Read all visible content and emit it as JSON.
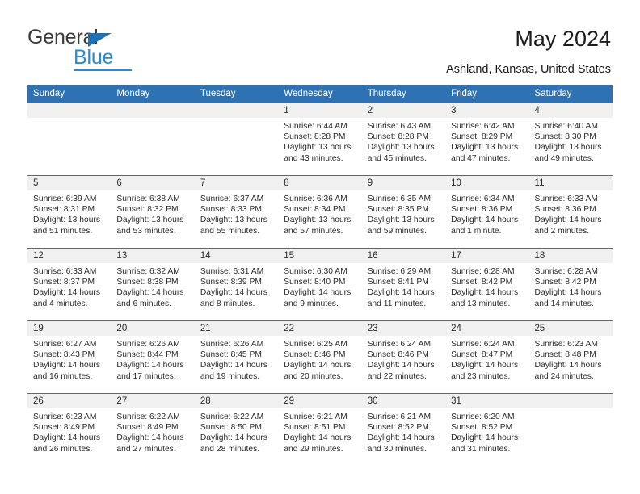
{
  "brand": {
    "name_part1": "General",
    "name_part2": "Blue",
    "triangle_color": "#1b70b8",
    "blue_color": "#2b8ad6"
  },
  "header": {
    "title": "May 2024",
    "location": "Ashland, Kansas, United States"
  },
  "theme": {
    "header_blue": "#2f72b4",
    "daynum_bg": "#f0f0f0",
    "text": "#2b2b2b"
  },
  "labels": {
    "sunrise_prefix": "Sunrise:",
    "sunset_prefix": "Sunset:",
    "daylight_prefix": "Daylight:"
  },
  "weekday_headers": [
    "Sunday",
    "Monday",
    "Tuesday",
    "Wednesday",
    "Thursday",
    "Friday",
    "Saturday"
  ],
  "weeks": [
    [
      {
        "day": "",
        "sunrise": "",
        "sunset": "",
        "daylight_line1": "",
        "daylight_line2": ""
      },
      {
        "day": "",
        "sunrise": "",
        "sunset": "",
        "daylight_line1": "",
        "daylight_line2": ""
      },
      {
        "day": "",
        "sunrise": "",
        "sunset": "",
        "daylight_line1": "",
        "daylight_line2": ""
      },
      {
        "day": "1",
        "sunrise": "Sunrise: 6:44 AM",
        "sunset": "Sunset: 8:28 PM",
        "daylight_line1": "Daylight: 13 hours",
        "daylight_line2": "and 43 minutes."
      },
      {
        "day": "2",
        "sunrise": "Sunrise: 6:43 AM",
        "sunset": "Sunset: 8:28 PM",
        "daylight_line1": "Daylight: 13 hours",
        "daylight_line2": "and 45 minutes."
      },
      {
        "day": "3",
        "sunrise": "Sunrise: 6:42 AM",
        "sunset": "Sunset: 8:29 PM",
        "daylight_line1": "Daylight: 13 hours",
        "daylight_line2": "and 47 minutes."
      },
      {
        "day": "4",
        "sunrise": "Sunrise: 6:40 AM",
        "sunset": "Sunset: 8:30 PM",
        "daylight_line1": "Daylight: 13 hours",
        "daylight_line2": "and 49 minutes."
      }
    ],
    [
      {
        "day": "5",
        "sunrise": "Sunrise: 6:39 AM",
        "sunset": "Sunset: 8:31 PM",
        "daylight_line1": "Daylight: 13 hours",
        "daylight_line2": "and 51 minutes."
      },
      {
        "day": "6",
        "sunrise": "Sunrise: 6:38 AM",
        "sunset": "Sunset: 8:32 PM",
        "daylight_line1": "Daylight: 13 hours",
        "daylight_line2": "and 53 minutes."
      },
      {
        "day": "7",
        "sunrise": "Sunrise: 6:37 AM",
        "sunset": "Sunset: 8:33 PM",
        "daylight_line1": "Daylight: 13 hours",
        "daylight_line2": "and 55 minutes."
      },
      {
        "day": "8",
        "sunrise": "Sunrise: 6:36 AM",
        "sunset": "Sunset: 8:34 PM",
        "daylight_line1": "Daylight: 13 hours",
        "daylight_line2": "and 57 minutes."
      },
      {
        "day": "9",
        "sunrise": "Sunrise: 6:35 AM",
        "sunset": "Sunset: 8:35 PM",
        "daylight_line1": "Daylight: 13 hours",
        "daylight_line2": "and 59 minutes."
      },
      {
        "day": "10",
        "sunrise": "Sunrise: 6:34 AM",
        "sunset": "Sunset: 8:36 PM",
        "daylight_line1": "Daylight: 14 hours",
        "daylight_line2": "and 1 minute."
      },
      {
        "day": "11",
        "sunrise": "Sunrise: 6:33 AM",
        "sunset": "Sunset: 8:36 PM",
        "daylight_line1": "Daylight: 14 hours",
        "daylight_line2": "and 2 minutes."
      }
    ],
    [
      {
        "day": "12",
        "sunrise": "Sunrise: 6:33 AM",
        "sunset": "Sunset: 8:37 PM",
        "daylight_line1": "Daylight: 14 hours",
        "daylight_line2": "and 4 minutes."
      },
      {
        "day": "13",
        "sunrise": "Sunrise: 6:32 AM",
        "sunset": "Sunset: 8:38 PM",
        "daylight_line1": "Daylight: 14 hours",
        "daylight_line2": "and 6 minutes."
      },
      {
        "day": "14",
        "sunrise": "Sunrise: 6:31 AM",
        "sunset": "Sunset: 8:39 PM",
        "daylight_line1": "Daylight: 14 hours",
        "daylight_line2": "and 8 minutes."
      },
      {
        "day": "15",
        "sunrise": "Sunrise: 6:30 AM",
        "sunset": "Sunset: 8:40 PM",
        "daylight_line1": "Daylight: 14 hours",
        "daylight_line2": "and 9 minutes."
      },
      {
        "day": "16",
        "sunrise": "Sunrise: 6:29 AM",
        "sunset": "Sunset: 8:41 PM",
        "daylight_line1": "Daylight: 14 hours",
        "daylight_line2": "and 11 minutes."
      },
      {
        "day": "17",
        "sunrise": "Sunrise: 6:28 AM",
        "sunset": "Sunset: 8:42 PM",
        "daylight_line1": "Daylight: 14 hours",
        "daylight_line2": "and 13 minutes."
      },
      {
        "day": "18",
        "sunrise": "Sunrise: 6:28 AM",
        "sunset": "Sunset: 8:42 PM",
        "daylight_line1": "Daylight: 14 hours",
        "daylight_line2": "and 14 minutes."
      }
    ],
    [
      {
        "day": "19",
        "sunrise": "Sunrise: 6:27 AM",
        "sunset": "Sunset: 8:43 PM",
        "daylight_line1": "Daylight: 14 hours",
        "daylight_line2": "and 16 minutes."
      },
      {
        "day": "20",
        "sunrise": "Sunrise: 6:26 AM",
        "sunset": "Sunset: 8:44 PM",
        "daylight_line1": "Daylight: 14 hours",
        "daylight_line2": "and 17 minutes."
      },
      {
        "day": "21",
        "sunrise": "Sunrise: 6:26 AM",
        "sunset": "Sunset: 8:45 PM",
        "daylight_line1": "Daylight: 14 hours",
        "daylight_line2": "and 19 minutes."
      },
      {
        "day": "22",
        "sunrise": "Sunrise: 6:25 AM",
        "sunset": "Sunset: 8:46 PM",
        "daylight_line1": "Daylight: 14 hours",
        "daylight_line2": "and 20 minutes."
      },
      {
        "day": "23",
        "sunrise": "Sunrise: 6:24 AM",
        "sunset": "Sunset: 8:46 PM",
        "daylight_line1": "Daylight: 14 hours",
        "daylight_line2": "and 22 minutes."
      },
      {
        "day": "24",
        "sunrise": "Sunrise: 6:24 AM",
        "sunset": "Sunset: 8:47 PM",
        "daylight_line1": "Daylight: 14 hours",
        "daylight_line2": "and 23 minutes."
      },
      {
        "day": "25",
        "sunrise": "Sunrise: 6:23 AM",
        "sunset": "Sunset: 8:48 PM",
        "daylight_line1": "Daylight: 14 hours",
        "daylight_line2": "and 24 minutes."
      }
    ],
    [
      {
        "day": "26",
        "sunrise": "Sunrise: 6:23 AM",
        "sunset": "Sunset: 8:49 PM",
        "daylight_line1": "Daylight: 14 hours",
        "daylight_line2": "and 26 minutes."
      },
      {
        "day": "27",
        "sunrise": "Sunrise: 6:22 AM",
        "sunset": "Sunset: 8:49 PM",
        "daylight_line1": "Daylight: 14 hours",
        "daylight_line2": "and 27 minutes."
      },
      {
        "day": "28",
        "sunrise": "Sunrise: 6:22 AM",
        "sunset": "Sunset: 8:50 PM",
        "daylight_line1": "Daylight: 14 hours",
        "daylight_line2": "and 28 minutes."
      },
      {
        "day": "29",
        "sunrise": "Sunrise: 6:21 AM",
        "sunset": "Sunset: 8:51 PM",
        "daylight_line1": "Daylight: 14 hours",
        "daylight_line2": "and 29 minutes."
      },
      {
        "day": "30",
        "sunrise": "Sunrise: 6:21 AM",
        "sunset": "Sunset: 8:52 PM",
        "daylight_line1": "Daylight: 14 hours",
        "daylight_line2": "and 30 minutes."
      },
      {
        "day": "31",
        "sunrise": "Sunrise: 6:20 AM",
        "sunset": "Sunset: 8:52 PM",
        "daylight_line1": "Daylight: 14 hours",
        "daylight_line2": "and 31 minutes."
      },
      {
        "day": "",
        "sunrise": "",
        "sunset": "",
        "daylight_line1": "",
        "daylight_line2": ""
      }
    ]
  ]
}
